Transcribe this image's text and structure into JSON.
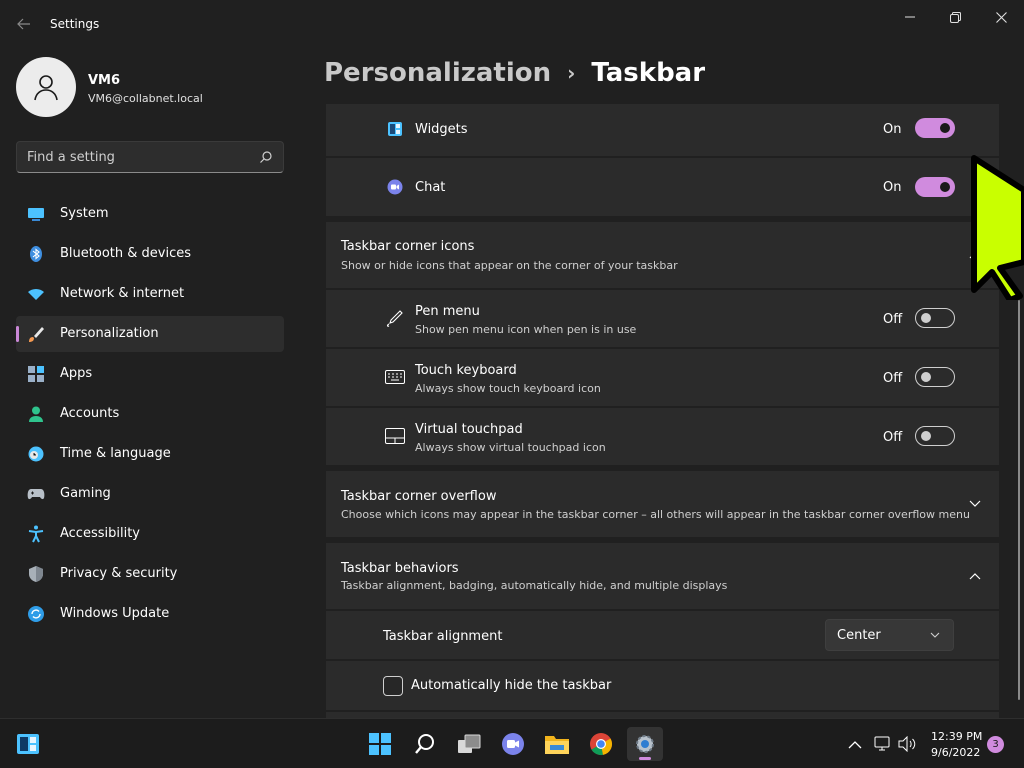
{
  "app": {
    "title": "Settings"
  },
  "user": {
    "name": "VM6",
    "email": "VM6@collabnet.local"
  },
  "search": {
    "placeholder": "Find a setting"
  },
  "nav": {
    "items": [
      {
        "label": "System"
      },
      {
        "label": "Bluetooth & devices"
      },
      {
        "label": "Network & internet"
      },
      {
        "label": "Personalization"
      },
      {
        "label": "Apps"
      },
      {
        "label": "Accounts"
      },
      {
        "label": "Time & language"
      },
      {
        "label": "Gaming"
      },
      {
        "label": "Accessibility"
      },
      {
        "label": "Privacy & security"
      },
      {
        "label": "Windows Update"
      }
    ],
    "selected": "Personalization"
  },
  "header": {
    "parent": "Personalization",
    "separator": "›",
    "current": "Taskbar"
  },
  "taskbar_items": {
    "widgets": {
      "label": "Widgets",
      "state": "On"
    },
    "chat": {
      "label": "Chat",
      "state": "On"
    }
  },
  "corner_icons": {
    "title": "Taskbar corner icons",
    "description": "Show or hide icons that appear on the corner of your taskbar",
    "items": [
      {
        "label": "Pen menu",
        "description": "Show pen menu icon when pen is in use",
        "state": "Off"
      },
      {
        "label": "Touch keyboard",
        "description": "Always show touch keyboard icon",
        "state": "Off"
      },
      {
        "label": "Virtual touchpad",
        "description": "Always show virtual touchpad icon",
        "state": "Off"
      }
    ]
  },
  "corner_overflow": {
    "title": "Taskbar corner overflow",
    "description": "Choose which icons may appear in the taskbar corner – all others will appear in the taskbar corner overflow menu"
  },
  "behaviors": {
    "title": "Taskbar behaviors",
    "description": "Taskbar alignment, badging, automatically hide, and multiple displays",
    "alignment": {
      "label": "Taskbar alignment",
      "value": "Center"
    },
    "auto_hide": {
      "label": "Automatically hide the taskbar",
      "checked": false
    }
  },
  "system_tray": {
    "time": "12:39 PM",
    "date": "9/6/2022",
    "notifications": "3"
  },
  "colors": {
    "accent": "#d08bde",
    "background": "#202020",
    "card": "#2b2b2b"
  }
}
